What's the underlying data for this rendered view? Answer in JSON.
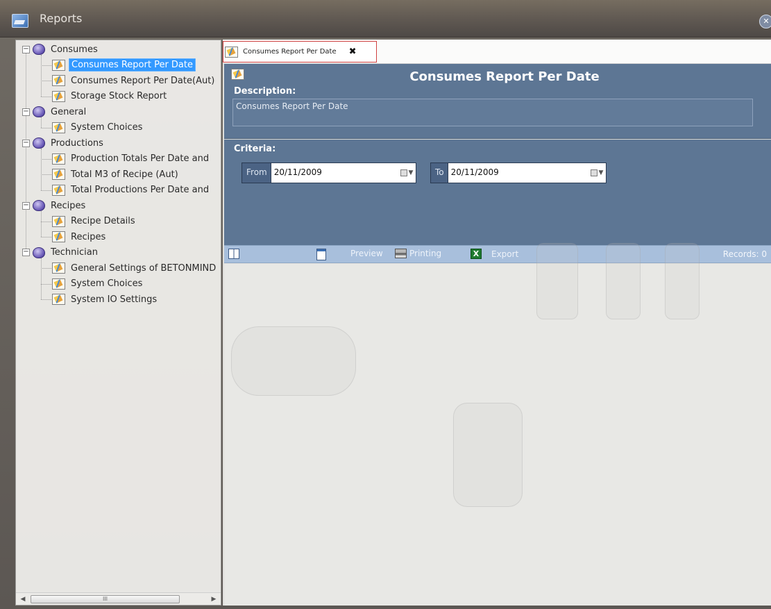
{
  "window": {
    "title": "Reports",
    "close_icon": "close-icon"
  },
  "tree": {
    "categories": [
      {
        "label": "Consumes",
        "expander": "−",
        "items": [
          "Consumes Report Per Date",
          "Consumes Report Per Date(Aut)",
          "Storage Stock Report"
        ]
      },
      {
        "label": "General",
        "expander": "−",
        "items": [
          "System Choices"
        ]
      },
      {
        "label": "Productions",
        "expander": "−",
        "items": [
          "Production Totals Per Date and",
          "Total M3 of Recipe (Aut)",
          "Total Productions Per Date and"
        ]
      },
      {
        "label": "Recipes",
        "expander": "−",
        "items": [
          "Recipe Details",
          "Recipes"
        ]
      },
      {
        "label": "Technician",
        "expander": "−",
        "items": [
          "General Settings of BETONMIND",
          "System Choices",
          "System IO Settings"
        ]
      }
    ],
    "selected_item": "Consumes Report Per Date",
    "scroll_left": "◀",
    "scroll_right": "▶",
    "scroll_grip": "III"
  },
  "tab": {
    "label": "Consumes Report Per Date",
    "close": "✖"
  },
  "report": {
    "title": "Consumes Report Per Date",
    "description_label": "Description:",
    "description": "Consumes Report Per Date",
    "criteria_label": "Criteria:",
    "from_label": "From",
    "from_value": "20/11/2009",
    "to_label": "To",
    "to_value": "20/11/2009",
    "drop_arrow": "▼"
  },
  "toolbar": {
    "preview": "Preview",
    "printing": "Printing",
    "export": "Export",
    "excel_glyph": "X",
    "records": "Records: 0"
  }
}
